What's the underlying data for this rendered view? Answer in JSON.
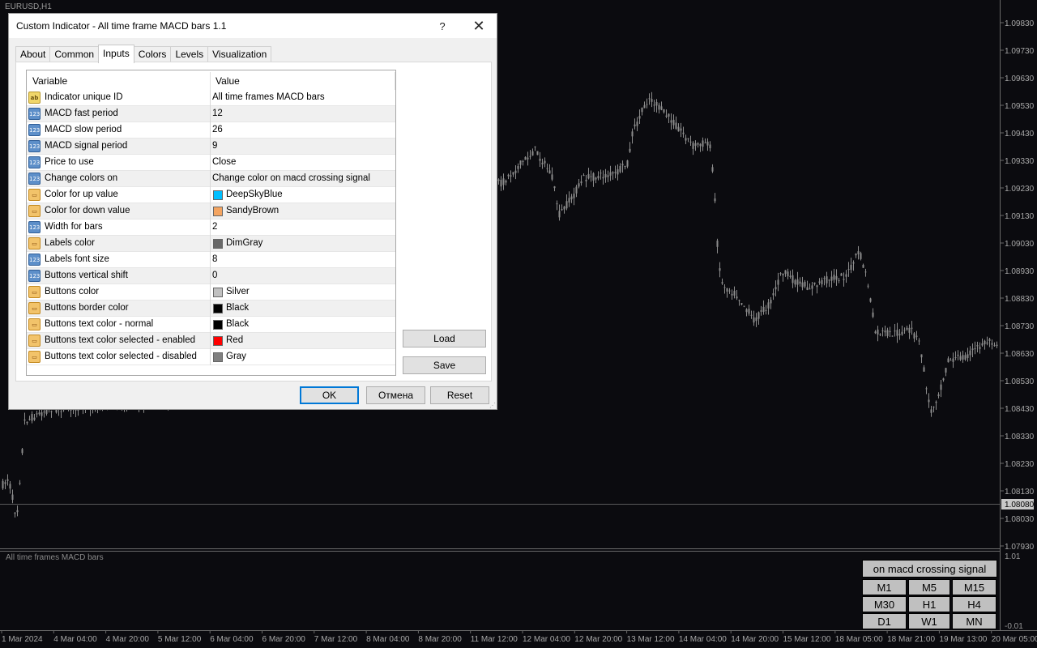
{
  "chart": {
    "symbol": "EURUSD,H1",
    "current_price": "1.08080",
    "price_ticks": [
      "1.09830",
      "1.09730",
      "1.09630",
      "1.09530",
      "1.09430",
      "1.09330",
      "1.09230",
      "1.09130",
      "1.09030",
      "1.08930",
      "1.08830",
      "1.08730",
      "1.08630",
      "1.08530",
      "1.08430",
      "1.08330",
      "1.08230",
      "1.08130",
      "1.08030",
      "1.07930"
    ],
    "time_ticks": [
      "1 Mar 2024",
      "4 Mar 04:00",
      "4 Mar 20:00",
      "5 Mar 12:00",
      "6 Mar 04:00",
      "6 Mar 20:00",
      "7 Mar 12:00",
      "8 Mar 04:00",
      "8 Mar 20:00",
      "11 Mar 12:00",
      "12 Mar 04:00",
      "12 Mar 20:00",
      "13 Mar 12:00",
      "14 Mar 04:00",
      "14 Mar 20:00",
      "15 Mar 12:00",
      "18 Mar 05:00",
      "18 Mar 21:00",
      "19 Mar 13:00",
      "20 Mar 05:00"
    ],
    "subwindow": {
      "title": "All time frames MACD bars",
      "scale_top": "1.01",
      "scale_bottom": "-0.01"
    },
    "colors": {
      "background": "#0b0b0f",
      "candles": "#8c8c8c",
      "grid": "#3a3a3a"
    }
  },
  "tf_buttons": {
    "signal": "on macd crossing signal",
    "frames": [
      "M1",
      "M5",
      "M15",
      "M30",
      "H1",
      "H4",
      "D1",
      "W1",
      "MN"
    ]
  },
  "dialog": {
    "title": "Custom Indicator - All time frame MACD bars 1.1",
    "help": "?",
    "close": "✕",
    "tabs": [
      "About",
      "Common",
      "Inputs",
      "Colors",
      "Levels",
      "Visualization"
    ],
    "active_tab": "Inputs",
    "columns": {
      "variable": "Variable",
      "value": "Value"
    },
    "inputs": [
      {
        "icon": "ab",
        "name": "Indicator unique ID",
        "value": "All time frames MACD bars"
      },
      {
        "icon": "num",
        "name": "MACD fast period",
        "value": "12"
      },
      {
        "icon": "num",
        "name": "MACD slow period",
        "value": "26"
      },
      {
        "icon": "num",
        "name": "MACD signal period",
        "value": "9"
      },
      {
        "icon": "num",
        "name": "Price to use",
        "value": "Close"
      },
      {
        "icon": "num",
        "name": "Change colors on",
        "value": "Change color on macd crossing signal"
      },
      {
        "icon": "clr",
        "name": "Color for up value",
        "value": "DeepSkyBlue",
        "swatch": "#00bfff"
      },
      {
        "icon": "clr",
        "name": "Color for down value",
        "value": "SandyBrown",
        "swatch": "#f4a460"
      },
      {
        "icon": "num",
        "name": "Width for bars",
        "value": "2"
      },
      {
        "icon": "clr",
        "name": "Labels color",
        "value": "DimGray",
        "swatch": "#696969"
      },
      {
        "icon": "num",
        "name": "Labels font size",
        "value": "8"
      },
      {
        "icon": "num",
        "name": "Buttons vertical shift",
        "value": "0"
      },
      {
        "icon": "clr",
        "name": "Buttons color",
        "value": "Silver",
        "swatch": "#c0c0c0"
      },
      {
        "icon": "clr",
        "name": "Buttons border color",
        "value": "Black",
        "swatch": "#000000"
      },
      {
        "icon": "clr",
        "name": "Buttons text color - normal",
        "value": "Black",
        "swatch": "#000000"
      },
      {
        "icon": "clr",
        "name": "Buttons text color selected - enabled",
        "value": "Red",
        "swatch": "#ff0000"
      },
      {
        "icon": "clr",
        "name": "Buttons text color selected - disabled",
        "value": "Gray",
        "swatch": "#808080"
      }
    ],
    "load": "Load",
    "save": "Save",
    "ok": "OK",
    "cancel": "Отмена",
    "reset": "Reset"
  }
}
